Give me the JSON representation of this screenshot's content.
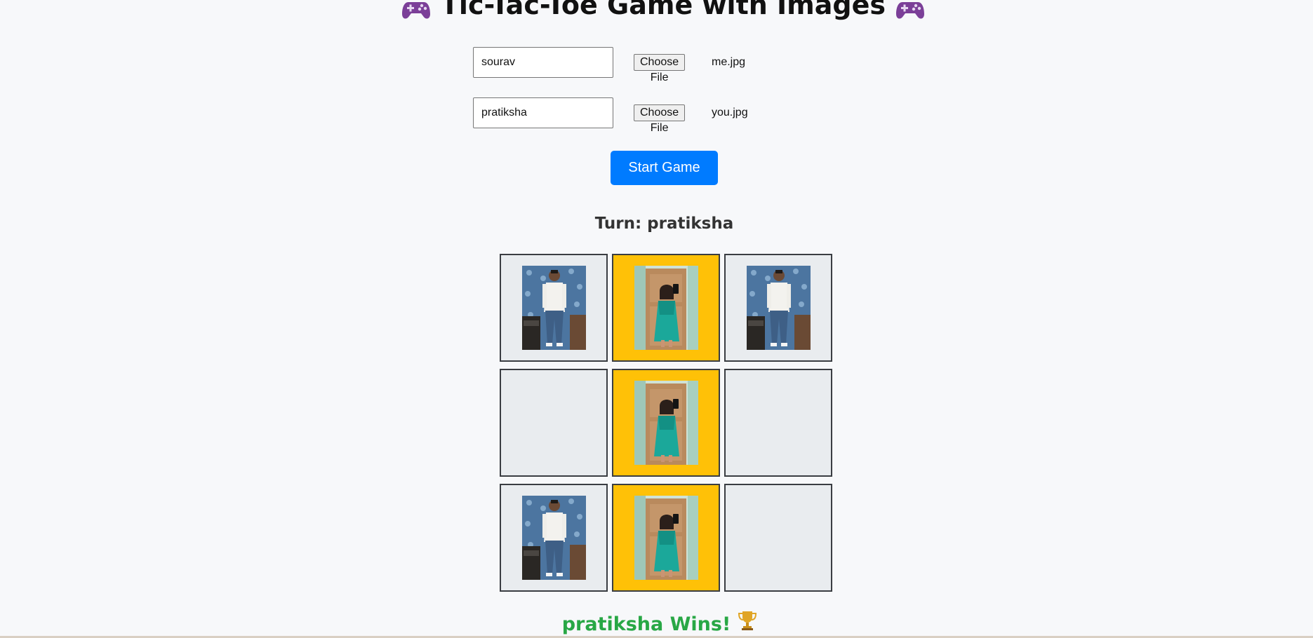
{
  "title": "Tic-Tac-Toe Game with Images",
  "players": [
    {
      "name_value": "sourav",
      "file_button_label": "Choose File",
      "file_name": "me.jpg"
    },
    {
      "name_value": "pratiksha",
      "file_button_label": "Choose File",
      "file_name": "you.jpg"
    }
  ],
  "start_button_label": "Start Game",
  "turn_text": "Turn: pratiksha",
  "board": [
    [
      "sourav",
      "pratiksha",
      "sourav"
    ],
    [
      "",
      "pratiksha",
      ""
    ],
    [
      "sourav",
      "pratiksha",
      ""
    ]
  ],
  "winner_text": "pratiksha Wins!",
  "icons": {
    "title_left": "game-controller-icon",
    "title_right": "game-controller-icon",
    "winner": "trophy-icon"
  },
  "colors": {
    "accent": "#007bff",
    "winner_text": "#28a745",
    "winning_cell": "#ffc107",
    "empty_cell": "#e9ecef"
  }
}
